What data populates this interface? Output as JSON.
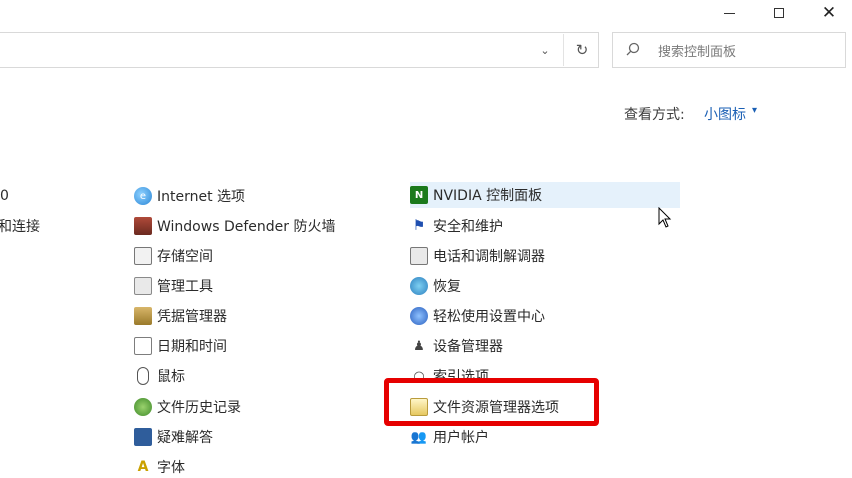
{
  "window": {
    "minimize_glyph": "—",
    "maximize_glyph": "□",
    "close_glyph": "✕"
  },
  "address_bar": {
    "dropdown_glyph": "⌄",
    "refresh_glyph": "↻"
  },
  "search": {
    "placeholder": "搜索控制面板",
    "icon": "search-icon"
  },
  "view_by": {
    "label": "查看方式:",
    "value": "小图标",
    "caret": "▾"
  },
  "column0": [
    {
      "label": "0"
    },
    {
      "label": "和连接"
    }
  ],
  "column1": [
    {
      "icon": "internet-options-icon",
      "label": "Internet 选项"
    },
    {
      "icon": "windows-defender-firewall-icon",
      "label": "Windows Defender 防火墙"
    },
    {
      "icon": "storage-spaces-icon",
      "label": "存储空间"
    },
    {
      "icon": "administrative-tools-icon",
      "label": "管理工具"
    },
    {
      "icon": "credential-manager-icon",
      "label": "凭据管理器"
    },
    {
      "icon": "date-time-icon",
      "label": "日期和时间"
    },
    {
      "icon": "mouse-icon",
      "label": "鼠标"
    },
    {
      "icon": "file-history-icon",
      "label": "文件历史记录"
    },
    {
      "icon": "troubleshooting-icon",
      "label": "疑难解答"
    },
    {
      "icon": "fonts-icon",
      "label": "字体"
    }
  ],
  "column2": [
    {
      "icon": "nvidia-icon",
      "label": "NVIDIA 控制面板"
    },
    {
      "icon": "security-maintenance-icon",
      "label": "安全和维护"
    },
    {
      "icon": "phone-modem-icon",
      "label": "电话和调制解调器"
    },
    {
      "icon": "recovery-icon",
      "label": "恢复"
    },
    {
      "icon": "ease-of-access-icon",
      "label": "轻松使用设置中心"
    },
    {
      "icon": "device-manager-icon",
      "label": "设备管理器"
    },
    {
      "icon": "indexing-options-icon",
      "label": "索引选项"
    },
    {
      "icon": "file-explorer-options-icon",
      "label": "文件资源管理器选项"
    },
    {
      "icon": "user-accounts-icon",
      "label": "用户帐户"
    }
  ],
  "highlight_color": "#e60000",
  "hover_color": "#e5f1fb",
  "link_color": "#1a5fb4"
}
